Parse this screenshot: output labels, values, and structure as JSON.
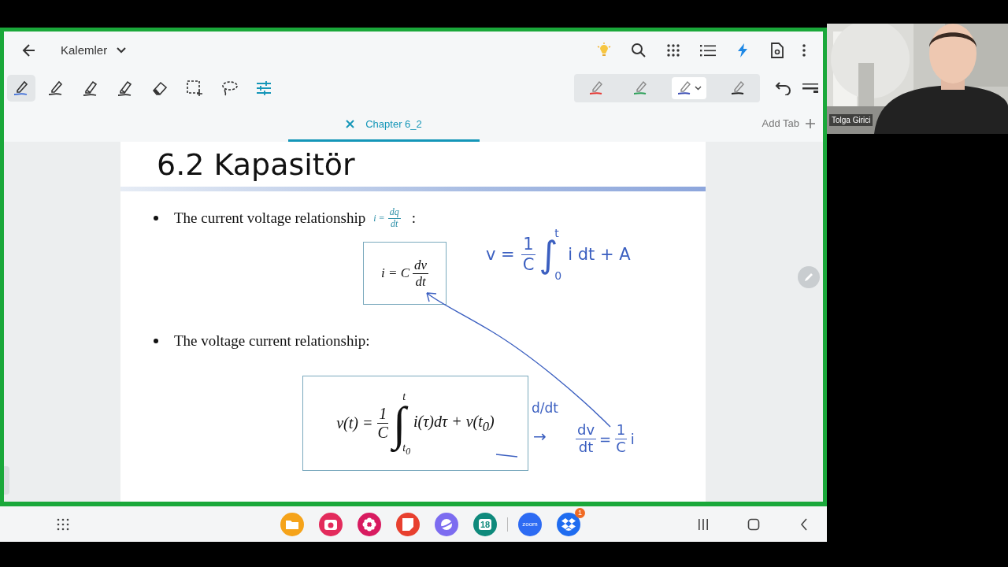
{
  "app_bar": {
    "title": "Kalemler"
  },
  "pen_tools": [
    {
      "kind": "pen",
      "selected": true
    },
    {
      "kind": "pen",
      "selected": false
    },
    {
      "kind": "highlighter",
      "selected": false
    },
    {
      "kind": "highlighter",
      "selected": false
    },
    {
      "kind": "eraser",
      "selected": false
    },
    {
      "kind": "select",
      "selected": false
    },
    {
      "kind": "lasso",
      "selected": false
    },
    {
      "kind": "settings",
      "selected": false
    }
  ],
  "pen_presets": [
    {
      "color": "#e53935",
      "selected": false
    },
    {
      "color": "#2ea05a",
      "selected": false
    },
    {
      "color": "#3f51b5",
      "selected": true
    },
    {
      "color": "#222222",
      "selected": false
    }
  ],
  "tabs": [
    {
      "label": "Chapter 6_2",
      "selected": true
    }
  ],
  "add_tab": "Add Tab",
  "slide": {
    "title": "6.2 Kapasitör",
    "bullets": [
      {
        "text": "The current voltage relationship",
        "formula": [
          {
            "kind": "text",
            "text": "i ="
          },
          {
            "kind": "frac",
            "num": "dq",
            "den": "dt"
          }
        ],
        "suffix": ":",
        "boxed": [
          {
            "kind": "text",
            "text": "i = C"
          },
          {
            "kind": "frac",
            "num": "dv",
            "den": "dt"
          }
        ]
      },
      {
        "text": "The voltage current relationship:",
        "boxed": [
          {
            "kind": "text",
            "text": "v(t) ="
          },
          {
            "kind": "frac",
            "num": "1",
            "den": "C"
          },
          {
            "kind": "int",
            "sign": "∫",
            "upper": "t",
            "lower": "t$_{0}$"
          },
          {
            "kind": "text",
            "text": "i(τ)dτ + v(t$_{0}$)"
          }
        ]
      }
    ],
    "ink": [
      {
        "parts": [
          {
            "kind": "text",
            "text": "v ="
          },
          {
            "kind": "frac",
            "num": "1",
            "den": "C"
          },
          {
            "kind": "int",
            "sign": "∫",
            "upper": "t",
            "lower": "0"
          },
          {
            "kind": "text",
            "text": "i dt   + A"
          }
        ]
      },
      {
        "parts": [
          {
            "kind": "text",
            "text": "d/dt"
          }
        ]
      },
      {
        "parts": [
          {
            "kind": "text",
            "text": "→"
          }
        ]
      },
      {
        "parts": [
          {
            "kind": "frac",
            "num": "dv",
            "den": "dt"
          },
          {
            "kind": "text",
            "text": "="
          },
          {
            "kind": "frac",
            "num": "1",
            "den": "C"
          },
          {
            "kind": "text",
            "text": "i"
          }
        ]
      }
    ]
  },
  "taskbar": {
    "apps": [
      {
        "kind": "folder",
        "color": "#f5a31a"
      },
      {
        "kind": "camera",
        "color": "#e32b5c"
      },
      {
        "kind": "flower",
        "color": "#d81b60"
      },
      {
        "kind": "notes",
        "color": "#e8402f"
      },
      {
        "kind": "planet",
        "color": "#7c6cf0"
      },
      {
        "kind": "calendar",
        "color": "#0f8a7c",
        "label": "18"
      }
    ],
    "recent_apps": [
      {
        "kind": "zoom",
        "color": "#2d6bf3",
        "label": "zoom"
      },
      {
        "kind": "dropbox",
        "color": "#1f6cf0",
        "badge": "1"
      }
    ]
  },
  "video": {
    "name": "Tolga Girici"
  }
}
